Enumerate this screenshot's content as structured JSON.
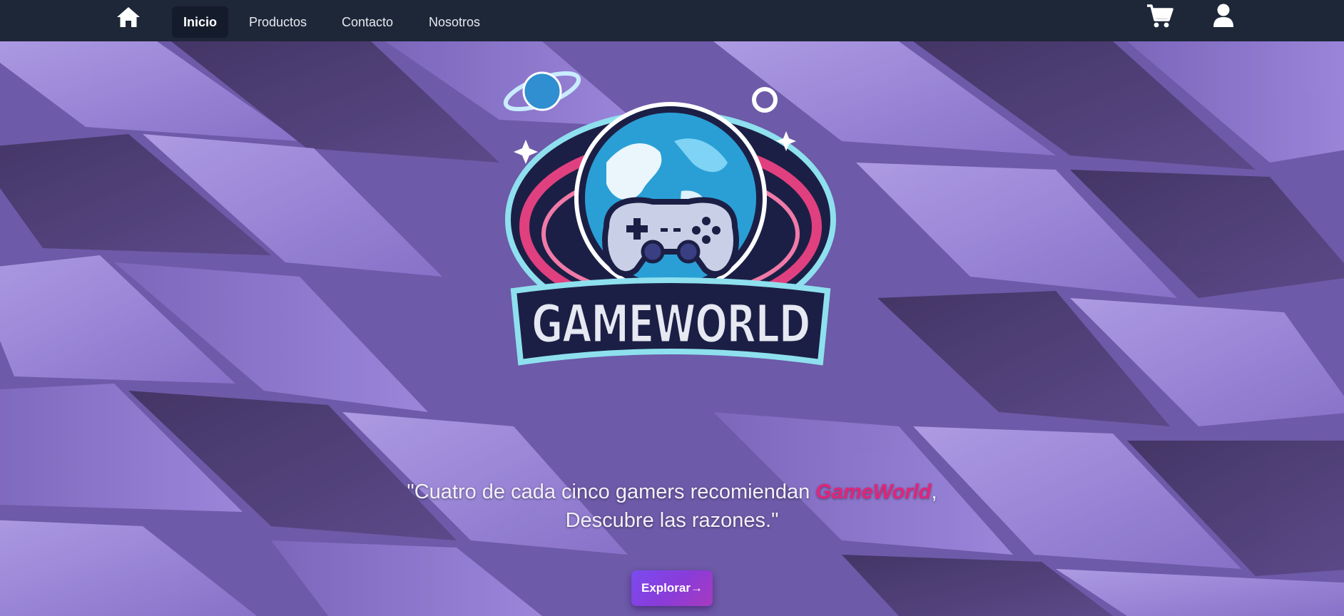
{
  "nav": {
    "home_icon": "home-icon",
    "links": [
      {
        "label": "Inicio",
        "active": true
      },
      {
        "label": "Productos",
        "active": false
      },
      {
        "label": "Contacto",
        "active": false
      },
      {
        "label": "Nosotros",
        "active": false
      }
    ],
    "cart_icon": "cart-icon",
    "user_icon": "user-icon"
  },
  "hero": {
    "logo_text": "GAMEWORLD",
    "tagline_line1_before": "\"Cuatro de cada cinco gamers recomiendan ",
    "tagline_brand": "GameWorld",
    "tagline_line1_after": ",",
    "tagline_line2": "Descubre las razones.\"",
    "button_label": "Explorar→"
  },
  "colors": {
    "navbar_bg": "#1e2738",
    "brand_pink": "#e3247a",
    "button_start": "#7a4bf0",
    "button_end": "#a73bbf"
  }
}
